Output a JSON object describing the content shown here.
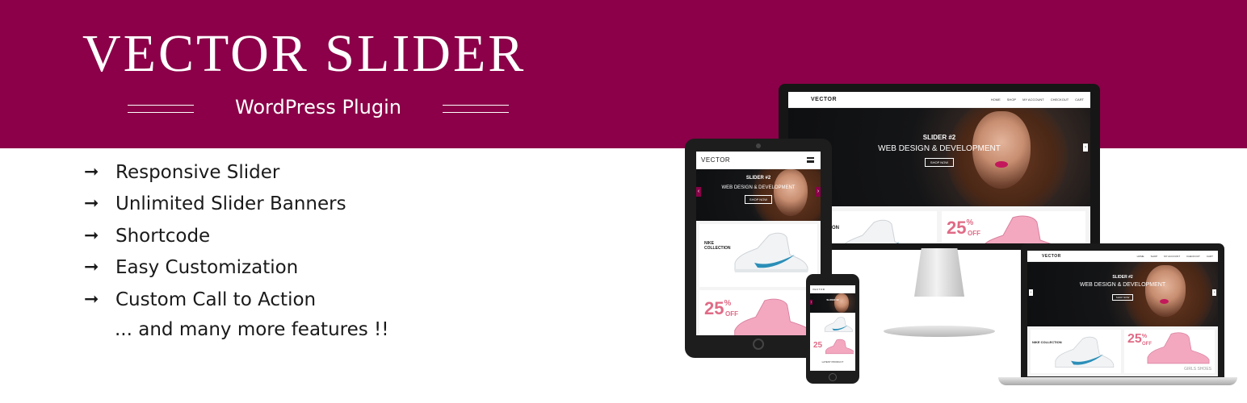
{
  "header": {
    "title": "VECTOR SLIDER",
    "subtitle": "WordPress Plugin"
  },
  "features": {
    "arrow": "➞",
    "items": [
      "Responsive Slider",
      "Unlimited Slider Banners",
      "Shortcode",
      "Easy Customization",
      "Custom Call to Action"
    ],
    "more": "... and many more features !!"
  },
  "colors": {
    "brand": "#8b0048",
    "accent_pink": "#e06b86"
  },
  "mockup_site": {
    "logo": "VECTOR",
    "nav": [
      "HOME",
      "SHOP",
      "MY ACCOUNT",
      "CHECKOUT",
      "CART"
    ],
    "slide_tag": "SLIDER #2",
    "slide_heading": "WEB DESIGN & DEVELOPMENT",
    "cta": "SHOP NOW",
    "banner_nike": "NIKE COLLECTION",
    "discount": "25",
    "discount_unit": "%",
    "discount_off": "OFF",
    "girls_shoes": "GIRLS SHOES",
    "latest": "LATEST PRODUCT",
    "prev_icon": "chevron-left-icon",
    "next_icon": "chevron-right-icon",
    "menu_icon": "hamburger-menu-icon"
  }
}
